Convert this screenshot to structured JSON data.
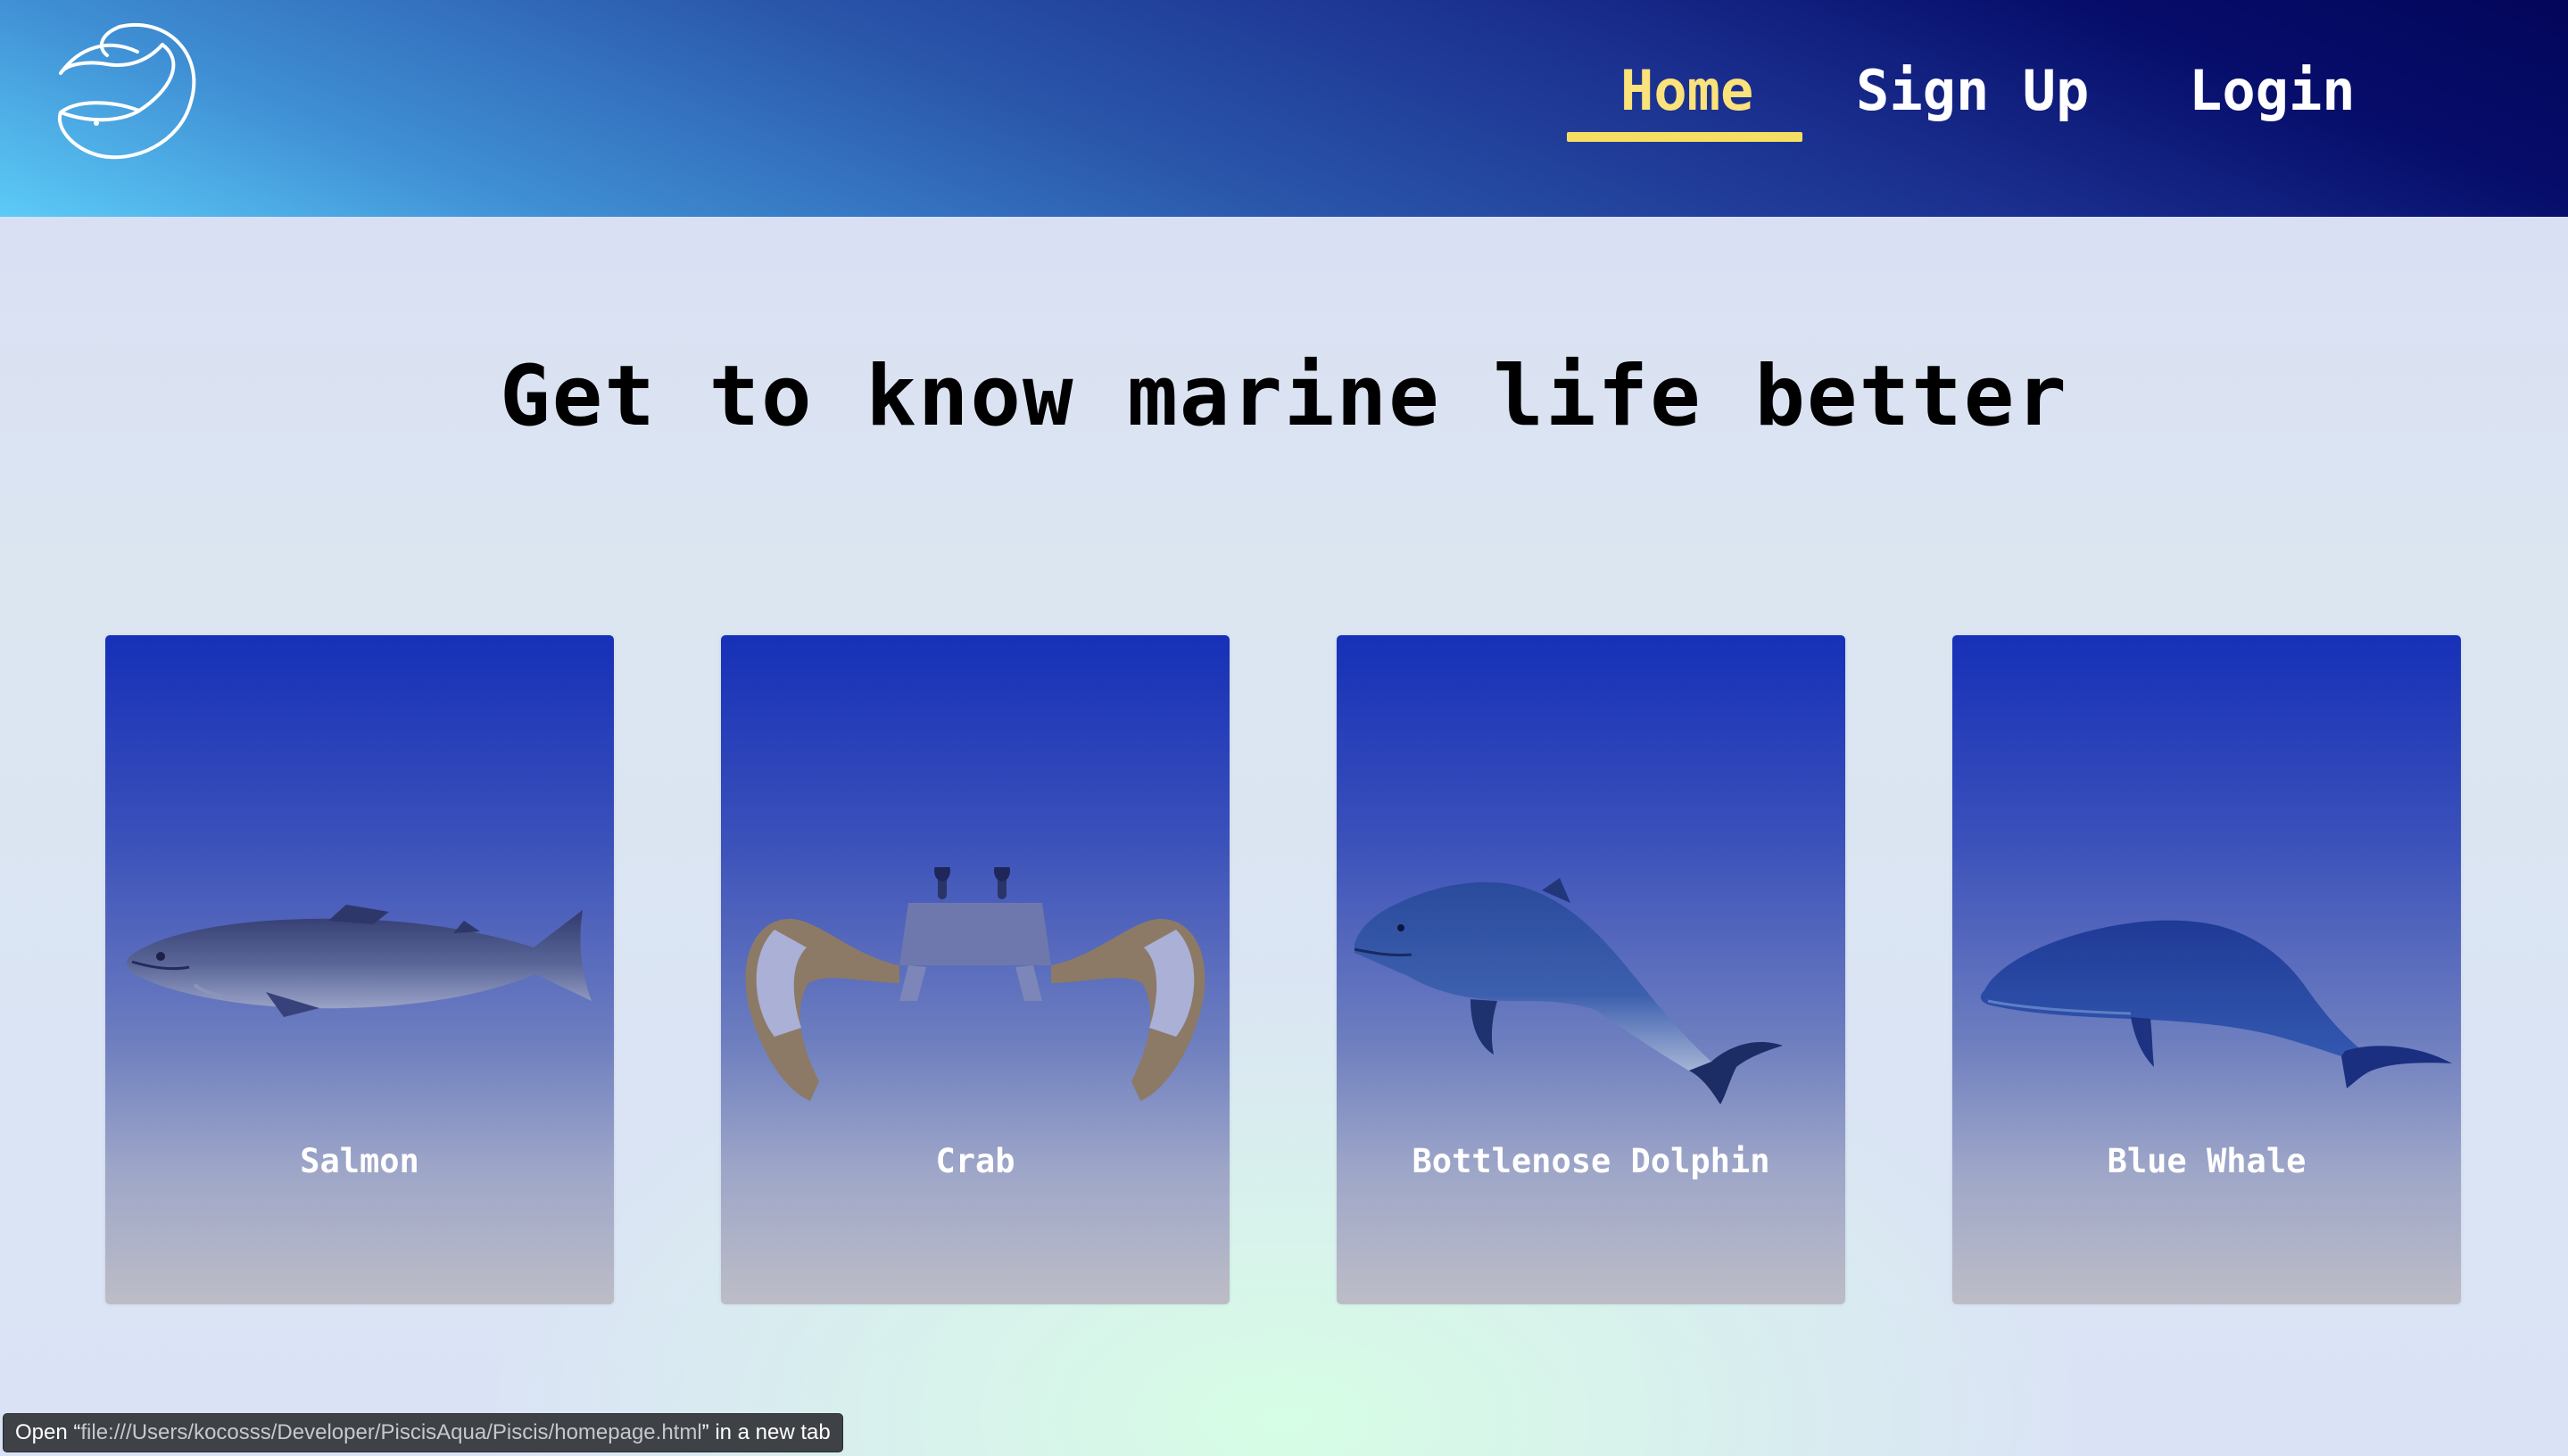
{
  "nav": {
    "links": [
      {
        "label": "Home",
        "active": true
      },
      {
        "label": "Sign Up",
        "active": false
      },
      {
        "label": "Login",
        "active": false
      }
    ],
    "logo_icon": "fish-logo-icon"
  },
  "colors": {
    "active_link": "#fbe27a",
    "underline": "#f4df62",
    "card_top": "#1630b8",
    "card_bottom": "#bdbdc7"
  },
  "hero": {
    "title": "Get to know marine life better"
  },
  "cards": [
    {
      "label": "Salmon",
      "image": "salmon-image"
    },
    {
      "label": "Crab",
      "image": "crab-image"
    },
    {
      "label": "Bottlenose Dolphin",
      "image": "dolphin-image"
    },
    {
      "label": "Blue Whale",
      "image": "blue-whale-image"
    }
  ],
  "status_bar": {
    "prefix": "Open “",
    "url": "file:///Users/kocosss/Developer/PiscisAqua/Piscis/homepage.html",
    "suffix": "” in a new tab"
  }
}
